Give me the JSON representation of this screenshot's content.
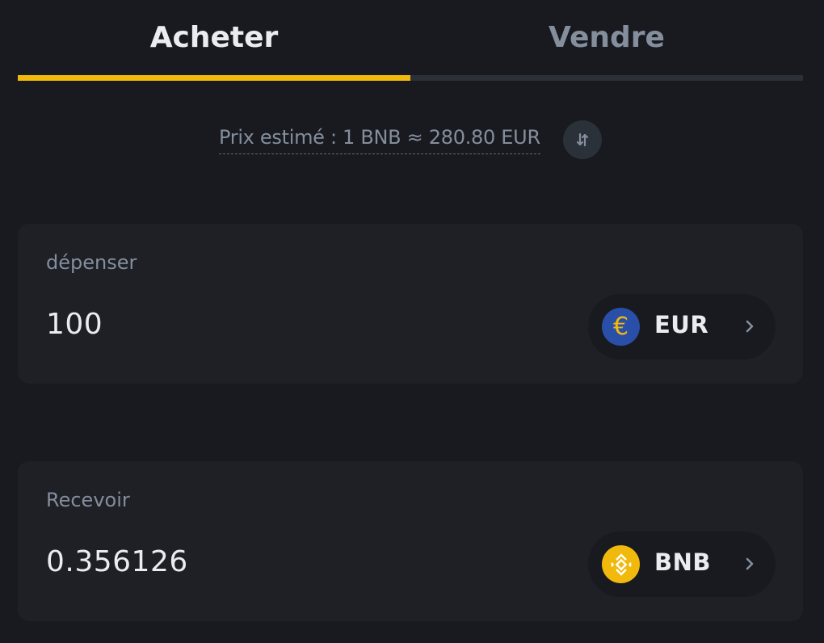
{
  "tabs": {
    "buy_label": "Acheter",
    "sell_label": "Vendre",
    "active": "buy"
  },
  "price": {
    "text": "Prix estimé : 1 BNB ≈ 280.80 EUR",
    "swap_icon": "swap-vertical-icon"
  },
  "spend": {
    "label": "dépenser",
    "value": "100",
    "currency_code": "EUR",
    "currency_icon": "euro-icon",
    "currency_symbol": "€"
  },
  "receive": {
    "label": "Recevoir",
    "value": "0.356126",
    "currency_code": "BNB",
    "currency_icon": "bnb-icon"
  },
  "colors": {
    "background": "#181a20",
    "card": "#1e2026",
    "accent": "#f0b90b",
    "text_primary": "#eaecef",
    "text_secondary": "#848e9c",
    "euro_coin": "#2a4fa8"
  }
}
